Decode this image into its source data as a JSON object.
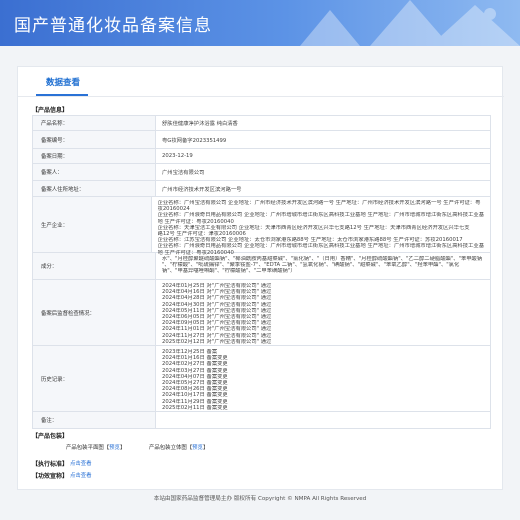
{
  "header": {
    "title": "国产普通化妆品备案信息"
  },
  "tab": {
    "label": "数据查看"
  },
  "sections": {
    "product_info": "【产品信息】",
    "packaging": "【产品包装】",
    "standard": "【执行标准】",
    "efficacy": "【功效宣称】"
  },
  "product": {
    "rows": [
      {
        "label": "产品名称：",
        "value": "舒肤佳健康净护沐浴露 纯白清香"
      },
      {
        "label": "备案编号：",
        "value": "粤G妆网备字2023351499"
      },
      {
        "label": "备案日期：",
        "value": "2023-12-19"
      },
      {
        "label": "备案人：",
        "value": "广州宝洁有限公司"
      },
      {
        "label": "备案人住所地址：",
        "value": "广州市经济技术开发区滨河路一号"
      }
    ],
    "producers": {
      "label": "生产企业：",
      "lines": [
        "企业名称：广州宝洁有限公司 企业地址：广州市经济技术开发区滨河路一号 生产地址：广州市经济技术开发区滨河路一号 生产许可证：粤",
        "妆20160024",
        "企业名称：广州浪奇日用品有限公司 企业地址：广州市增城市增江街东区高科技工业基地 生产地址：广州市增城市增江街东区高科技工业基",
        "地 生产许可证：粤妆20160040",
        "企业名称：天津宝洁工业有限公司 企业地址：天津市西青区经济开发区兴华七支路12号 生产地址：天津市西青区经济开发区兴华七支",
        "路12号 生产许可证：津妆20160006",
        "企业名称：江苏宝洁有限公司 企业地址：太仓市浏家港东路88号 生产地址：太仓市浏家港东路88号 生产许可证：苏妆20160017",
        "企业名称：广州浪奇日用品有限公司 企业地址：广州市增城市增江街东区高科技工业基地 生产地址：广州市增城市增江街东区高科技工业基",
        "地 生产许可证：粤妆20160040"
      ]
    },
    "ingredients": {
      "label": "成分：",
      "lines": [
        "水\"、\"月桂醇聚醚硫酸酯钠\"、\"椰油酰胺丙基甜菜碱\"、\"氯化钠\"、\"（日用）香精\"、\"月桂醇硫酸酯钠\"、\"乙二醇二硬脂酸酯\"、\"苯甲酸钠",
        "\"、\"柠檬酸\"、\"吡硫鎓锌\"、\"聚季铵盐-7\"、\"EDTA 二钠\"、\"氢氧化钠\"、\"碘酸钠\"、\"甜菜碱\"、\"苯氧乙醇\"、\"羟苯甲酯\"、\"氯化",
        "钠\"、\"甲基异噻唑啉酮\"、\"柠檬酸钠\"、\"二甲苯磺酸钠\"）"
      ]
    },
    "inspections": {
      "label": "备案后监督检查情况：",
      "lines": [
        "2024年01月25日 对\"广州宝洁有限公司\" 通过",
        "2024年04月16日 对\"广州宝洁有限公司\" 通过",
        "2024年04月28日 对\"广州宝洁有限公司\" 通过",
        "2024年04月30日 对\"广州宝洁有限公司\" 通过",
        "2024年05月11日 对\"广州宝洁有限公司\" 通过",
        "2024年06月05日 对\"广州宝洁有限公司\" 通过",
        "2024年09月05日 对\"广州宝洁有限公司\" 通过",
        "2024年11月01日 对\"广州宝洁有限公司\" 通过",
        "2024年11月27日 对\"广州宝洁有限公司\" 通过",
        "2025年02月12日 对\"广州宝洁有限公司\" 通过"
      ]
    },
    "history": {
      "label": "历史记录：",
      "lines": [
        "2023年12月25日 备案",
        "2024年01月16日 备案变更",
        "2024年02月27日 备案变更",
        "2024年03月27日 备案变更",
        "2024年04月07日 备案变更",
        "2024年05月27日 备案变更",
        "2024年08月26日 备案变更",
        "2024年10月17日 备案变更",
        "2024年11月29日 备案变更",
        "2025年02月11日 备案变更"
      ]
    },
    "remark": {
      "label": "备注：",
      "value": ""
    }
  },
  "packaging": {
    "flat_label": "产品包装平面图【",
    "flat_link": "预览",
    "flat_close": "】",
    "solid_label": "产品包装立体图【",
    "solid_link": "预览",
    "solid_close": "】"
  },
  "standard": {
    "link": "点击查看"
  },
  "efficacy": {
    "link": "点击查看"
  },
  "footer": {
    "text": "本站由国家药品监督管理局主办  版权所有 Copyright © NMPA All Rights Reserved"
  }
}
